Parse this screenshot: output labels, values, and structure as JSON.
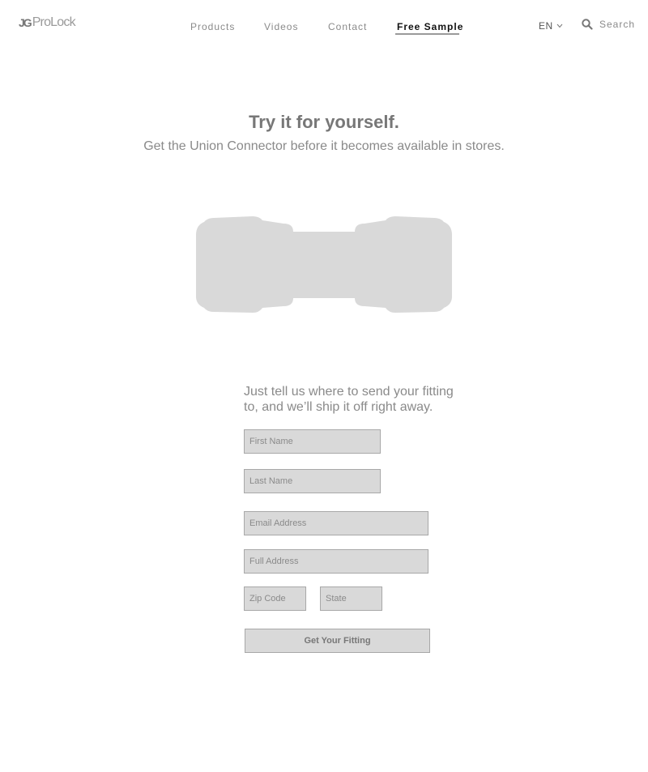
{
  "brand": {
    "mark": "JG",
    "name": "ProLock"
  },
  "nav": {
    "items": [
      {
        "label": "Products",
        "active": false
      },
      {
        "label": "Videos",
        "active": false
      },
      {
        "label": "Contact",
        "active": false
      },
      {
        "label": "Free Sample",
        "active": true
      }
    ],
    "language": "EN",
    "search_label": "Search"
  },
  "hero": {
    "title": "Try it for yourself.",
    "subtitle": "Get the Union Connector before it becomes available in stores.",
    "product_image": "union-connector-silhouette"
  },
  "form": {
    "intro": "Just tell us where to send your fitting to, and we’ll ship it off right away.",
    "fields": {
      "first_name": {
        "placeholder": "First Name",
        "value": ""
      },
      "last_name": {
        "placeholder": "Last Name",
        "value": ""
      },
      "email": {
        "placeholder": "Email Address",
        "value": ""
      },
      "full_address": {
        "placeholder": "Full Address",
        "value": ""
      },
      "zip": {
        "placeholder": "Zip Code",
        "value": ""
      },
      "state": {
        "placeholder": "State",
        "value": ""
      }
    },
    "submit_label": "Get Your Fitting"
  },
  "colors": {
    "fill": "#d9d9d9",
    "border": "#a8a8a8",
    "text": "#8a8a8a"
  }
}
